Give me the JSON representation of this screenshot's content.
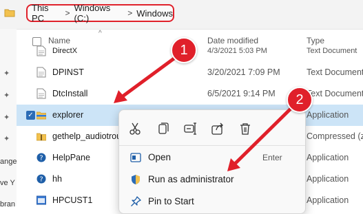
{
  "address_bar": {
    "breadcrumbs": [
      "This PC",
      "Windows (C:)",
      "Windows"
    ],
    "separator": ">"
  },
  "nav_pane": {
    "partial_labels": [
      "ange",
      "ve Y",
      "bran"
    ]
  },
  "columns": {
    "name": "Name",
    "date_modified": "Date modified",
    "type": "Type"
  },
  "files": [
    {
      "name": "DirectX",
      "date": "4/3/2021 5:03 PM",
      "type": "Text Document"
    },
    {
      "name": "DPINST",
      "date": "3/20/2021 7:09 PM",
      "type": "Text Document"
    },
    {
      "name": "DtcInstall",
      "date": "6/5/2021 9:14 PM",
      "type": "Text Document"
    },
    {
      "name": "explorer",
      "date": "",
      "type": "Application"
    },
    {
      "name": "gethelp_audiotrou",
      "date": "",
      "type": "Compressed (zi"
    },
    {
      "name": "HelpPane",
      "date": "",
      "type": "Application"
    },
    {
      "name": "hh",
      "date": "",
      "type": "Application"
    },
    {
      "name": "HPCUST1",
      "date": "",
      "type": "Application"
    }
  ],
  "context_menu": {
    "toolbar_icons": [
      "cut-icon",
      "copy-icon",
      "rename-icon",
      "share-icon",
      "delete-icon"
    ],
    "items": [
      {
        "label": "Open",
        "shortcut": "Enter"
      },
      {
        "label": "Run as administrator",
        "shortcut": ""
      },
      {
        "label": "Pin to Start",
        "shortcut": ""
      }
    ]
  },
  "callouts": {
    "first": "1",
    "second": "2"
  },
  "colors": {
    "accent_red": "#e0202a",
    "selection": "#cce4f7",
    "folder_yellow": "#f2c14e"
  }
}
